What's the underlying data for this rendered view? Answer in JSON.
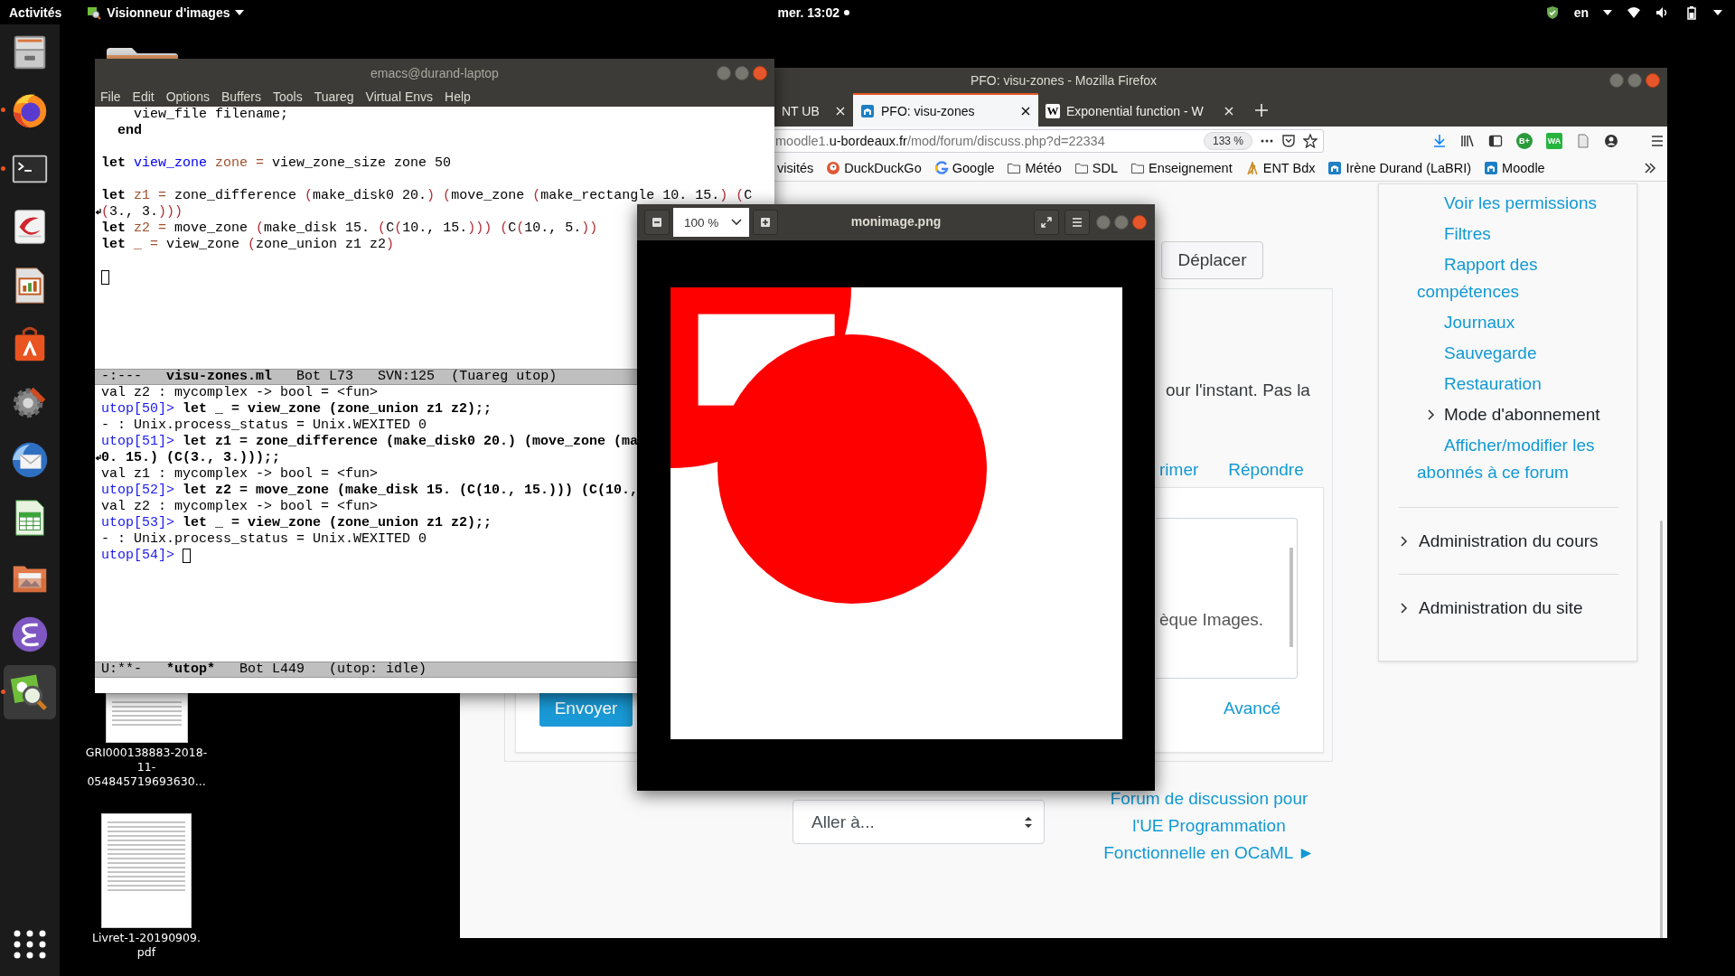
{
  "top_bar": {
    "activities": "Activités",
    "app_menu": "Visionneur d'images",
    "clock": "mer. 13:02",
    "keyboard": "en"
  },
  "dock": [
    {
      "kind": "files",
      "running": false,
      "active": false
    },
    {
      "kind": "browser",
      "running": true,
      "active": false
    },
    {
      "kind": "terminal",
      "running": true,
      "active": false
    },
    {
      "kind": "document",
      "running": false,
      "active": false
    },
    {
      "kind": "presentation",
      "running": false,
      "active": false
    },
    {
      "kind": "store",
      "running": false,
      "active": false
    },
    {
      "kind": "settings",
      "running": false,
      "active": false
    },
    {
      "kind": "mail",
      "running": false,
      "active": false
    },
    {
      "kind": "spreadsheet",
      "running": false,
      "active": false
    },
    {
      "kind": "photos",
      "running": false,
      "active": false
    },
    {
      "kind": "editor",
      "running": false,
      "active": false
    },
    {
      "kind": "viewer",
      "running": true,
      "active": true
    }
  ],
  "desktop_icons": [
    {
      "kind": "folder"
    },
    {
      "kind": "document",
      "label_lines": [
        "GRI000138883-2018-",
        "11-",
        "054845719693630..."
      ]
    },
    {
      "kind": "document",
      "label_lines": [
        "Livret-1-20190909.",
        "pdf"
      ]
    }
  ],
  "firefox": {
    "title": "PFO: visu-zones - Mozilla Firefox",
    "tabs": [
      {
        "label": "NT UB",
        "selected": false
      },
      {
        "label": "PFO: visu-zones",
        "selected": true
      },
      {
        "label": "Exponential function - W",
        "icon_letter": "W",
        "selected": false
      }
    ],
    "url": {
      "prefix": "moodle1.",
      "host": "u-bordeaux.fr",
      "path": "/mod/forum/discuss.php?d=22334"
    },
    "zoom": "133 %",
    "extensions": [
      "B+",
      "WA"
    ],
    "bookmarks": [
      "visités",
      "DuckDuckGo",
      "Google",
      "Météo",
      "SDL",
      "Enseignement",
      "ENT Bdx",
      "Irène Durand (LaBRI)",
      "Moodle"
    ],
    "page": {
      "move_button": "Déplacer",
      "post_text": "our l'instant. Pas la",
      "post_links": [
        "rimer",
        "Répondre"
      ],
      "reply_text": "èque Images.",
      "send_button": "Envoyer",
      "advanced_link": "Avancé",
      "jump_select": "Aller à...",
      "next_link_lines": [
        "Forum de discussion pour",
        "l'UE Programmation",
        "Fonctionnelle en OCaML ►"
      ]
    },
    "sidebar": {
      "items": [
        {
          "label": "Voir les permissions",
          "kind": "link"
        },
        {
          "label": "Filtres",
          "kind": "link"
        },
        {
          "label": "Rapport des compétences",
          "kind": "link"
        },
        {
          "label": "Journaux",
          "kind": "link"
        },
        {
          "label": "Sauvegarde",
          "kind": "link"
        },
        {
          "label": "Restauration",
          "kind": "link"
        },
        {
          "label": "Mode d'abonnement",
          "kind": "branch",
          "expanded": false
        },
        {
          "label": "Afficher/modifier les abonnés à ce forum",
          "kind": "link"
        }
      ],
      "sections": [
        {
          "label": "Administration du cours",
          "expanded": false
        },
        {
          "label": "Administration du site",
          "expanded": false
        }
      ]
    }
  },
  "emacs": {
    "title": "emacs@durand-laptop",
    "menu": [
      "File",
      "Edit",
      "Options",
      "Buffers",
      "Tools",
      "Tuareg",
      "Virtual Envs",
      "Help"
    ],
    "editor_lines": [
      {
        "kind": "code",
        "tokens": [
          {
            "kind": "plain",
            "text": "    view_file filename;"
          }
        ]
      },
      {
        "kind": "code",
        "tokens": [
          {
            "kind": "keyword",
            "text": "  end"
          }
        ]
      },
      {
        "kind": "blank"
      },
      {
        "kind": "code",
        "tokens": [
          {
            "kind": "keyword",
            "text": "let"
          },
          {
            "kind": "function",
            "text": " view_zone"
          },
          {
            "kind": "variable",
            "text": " zone ="
          },
          {
            "kind": "plain",
            "text": " view_zone_size zone 50"
          }
        ]
      },
      {
        "kind": "blank"
      },
      {
        "kind": "code",
        "tokens": [
          {
            "kind": "keyword",
            "text": "let"
          },
          {
            "kind": "variable",
            "text": " z1 ="
          },
          {
            "kind": "plain",
            "text": " zone_difference "
          },
          {
            "kind": "paren",
            "text": "("
          },
          {
            "kind": "plain",
            "text": "make_disk0 20."
          },
          {
            "kind": "paren",
            "text": ") ("
          },
          {
            "kind": "plain",
            "text": "move_zone "
          },
          {
            "kind": "paren",
            "text": "("
          },
          {
            "kind": "plain",
            "text": "make_rectangle 10. 15."
          },
          {
            "kind": "paren",
            "text": ") ("
          },
          {
            "kind": "plain",
            "text": "C"
          }
        ]
      },
      {
        "kind": "continuation",
        "tokens": [
          {
            "kind": "paren",
            "text": "("
          },
          {
            "kind": "plain",
            "text": "3., 3."
          },
          {
            "kind": "paren",
            "text": ")))"
          }
        ]
      },
      {
        "kind": "code",
        "tokens": [
          {
            "kind": "keyword",
            "text": "let"
          },
          {
            "kind": "variable",
            "text": " z2 ="
          },
          {
            "kind": "plain",
            "text": " move_zone "
          },
          {
            "kind": "paren",
            "text": "("
          },
          {
            "kind": "plain",
            "text": "make_disk 15. "
          },
          {
            "kind": "paren",
            "text": "("
          },
          {
            "kind": "plain",
            "text": "C"
          },
          {
            "kind": "paren",
            "text": "("
          },
          {
            "kind": "plain",
            "text": "10., 15."
          },
          {
            "kind": "paren",
            "text": "))) ("
          },
          {
            "kind": "plain",
            "text": "C"
          },
          {
            "kind": "paren",
            "text": "("
          },
          {
            "kind": "plain",
            "text": "10., 5."
          },
          {
            "kind": "paren",
            "text": "))"
          }
        ]
      },
      {
        "kind": "code",
        "tokens": [
          {
            "kind": "keyword",
            "text": "let"
          },
          {
            "kind": "variable",
            "text": " _ ="
          },
          {
            "kind": "plain",
            "text": " view_zone "
          },
          {
            "kind": "paren",
            "text": "("
          },
          {
            "kind": "plain",
            "text": "zone_union z1 z2"
          },
          {
            "kind": "paren",
            "text": ")"
          }
        ]
      },
      {
        "kind": "blank"
      },
      {
        "kind": "cursor"
      }
    ],
    "mode_line": {
      "status": "-:---",
      "buffer": "visu-zones.ml",
      "position": "Bot L73",
      "extra": "SVN:125",
      "mode": "(Tuareg utop)"
    },
    "repl_lines": [
      {
        "kind": "output",
        "text": "val z2 : mycomplex -> bool = <fun>"
      },
      {
        "kind": "input",
        "prompt": "utop[50]>",
        "text": "let _ = view_zone (zone_union z1 z2);;"
      },
      {
        "kind": "output",
        "text": "- : Unix.process_status = Unix.WEXITED 0"
      },
      {
        "kind": "input",
        "prompt": "utop[51]>",
        "text": "let z1 = zone_difference (make_disk0 20.) (move_zone (ma"
      },
      {
        "kind": "continuation",
        "text": "0. 15.) (C(3., 3.)));;"
      },
      {
        "kind": "output",
        "text": "val z1 : mycomplex -> bool = <fun>"
      },
      {
        "kind": "input",
        "prompt": "utop[52]>",
        "text": "let z2 = move_zone (make_disk 15. (C(10., 15.))) (C(10.,"
      },
      {
        "kind": "output",
        "text": "val z2 : mycomplex -> bool = <fun>"
      },
      {
        "kind": "input",
        "prompt": "utop[53]>",
        "text": "let _ = view_zone (zone_union z1 z2);;"
      },
      {
        "kind": "output",
        "text": "- : Unix.process_status = Unix.WEXITED 0"
      },
      {
        "kind": "prompt",
        "prompt": "utop[54]>"
      }
    ],
    "repl_mode_line": {
      "status": "U:**-",
      "buffer": "*utop*",
      "position": "Bot L449",
      "mode": "(utop: idle)"
    }
  },
  "viewer": {
    "title": "monimage.png",
    "zoom": "100 %"
  }
}
